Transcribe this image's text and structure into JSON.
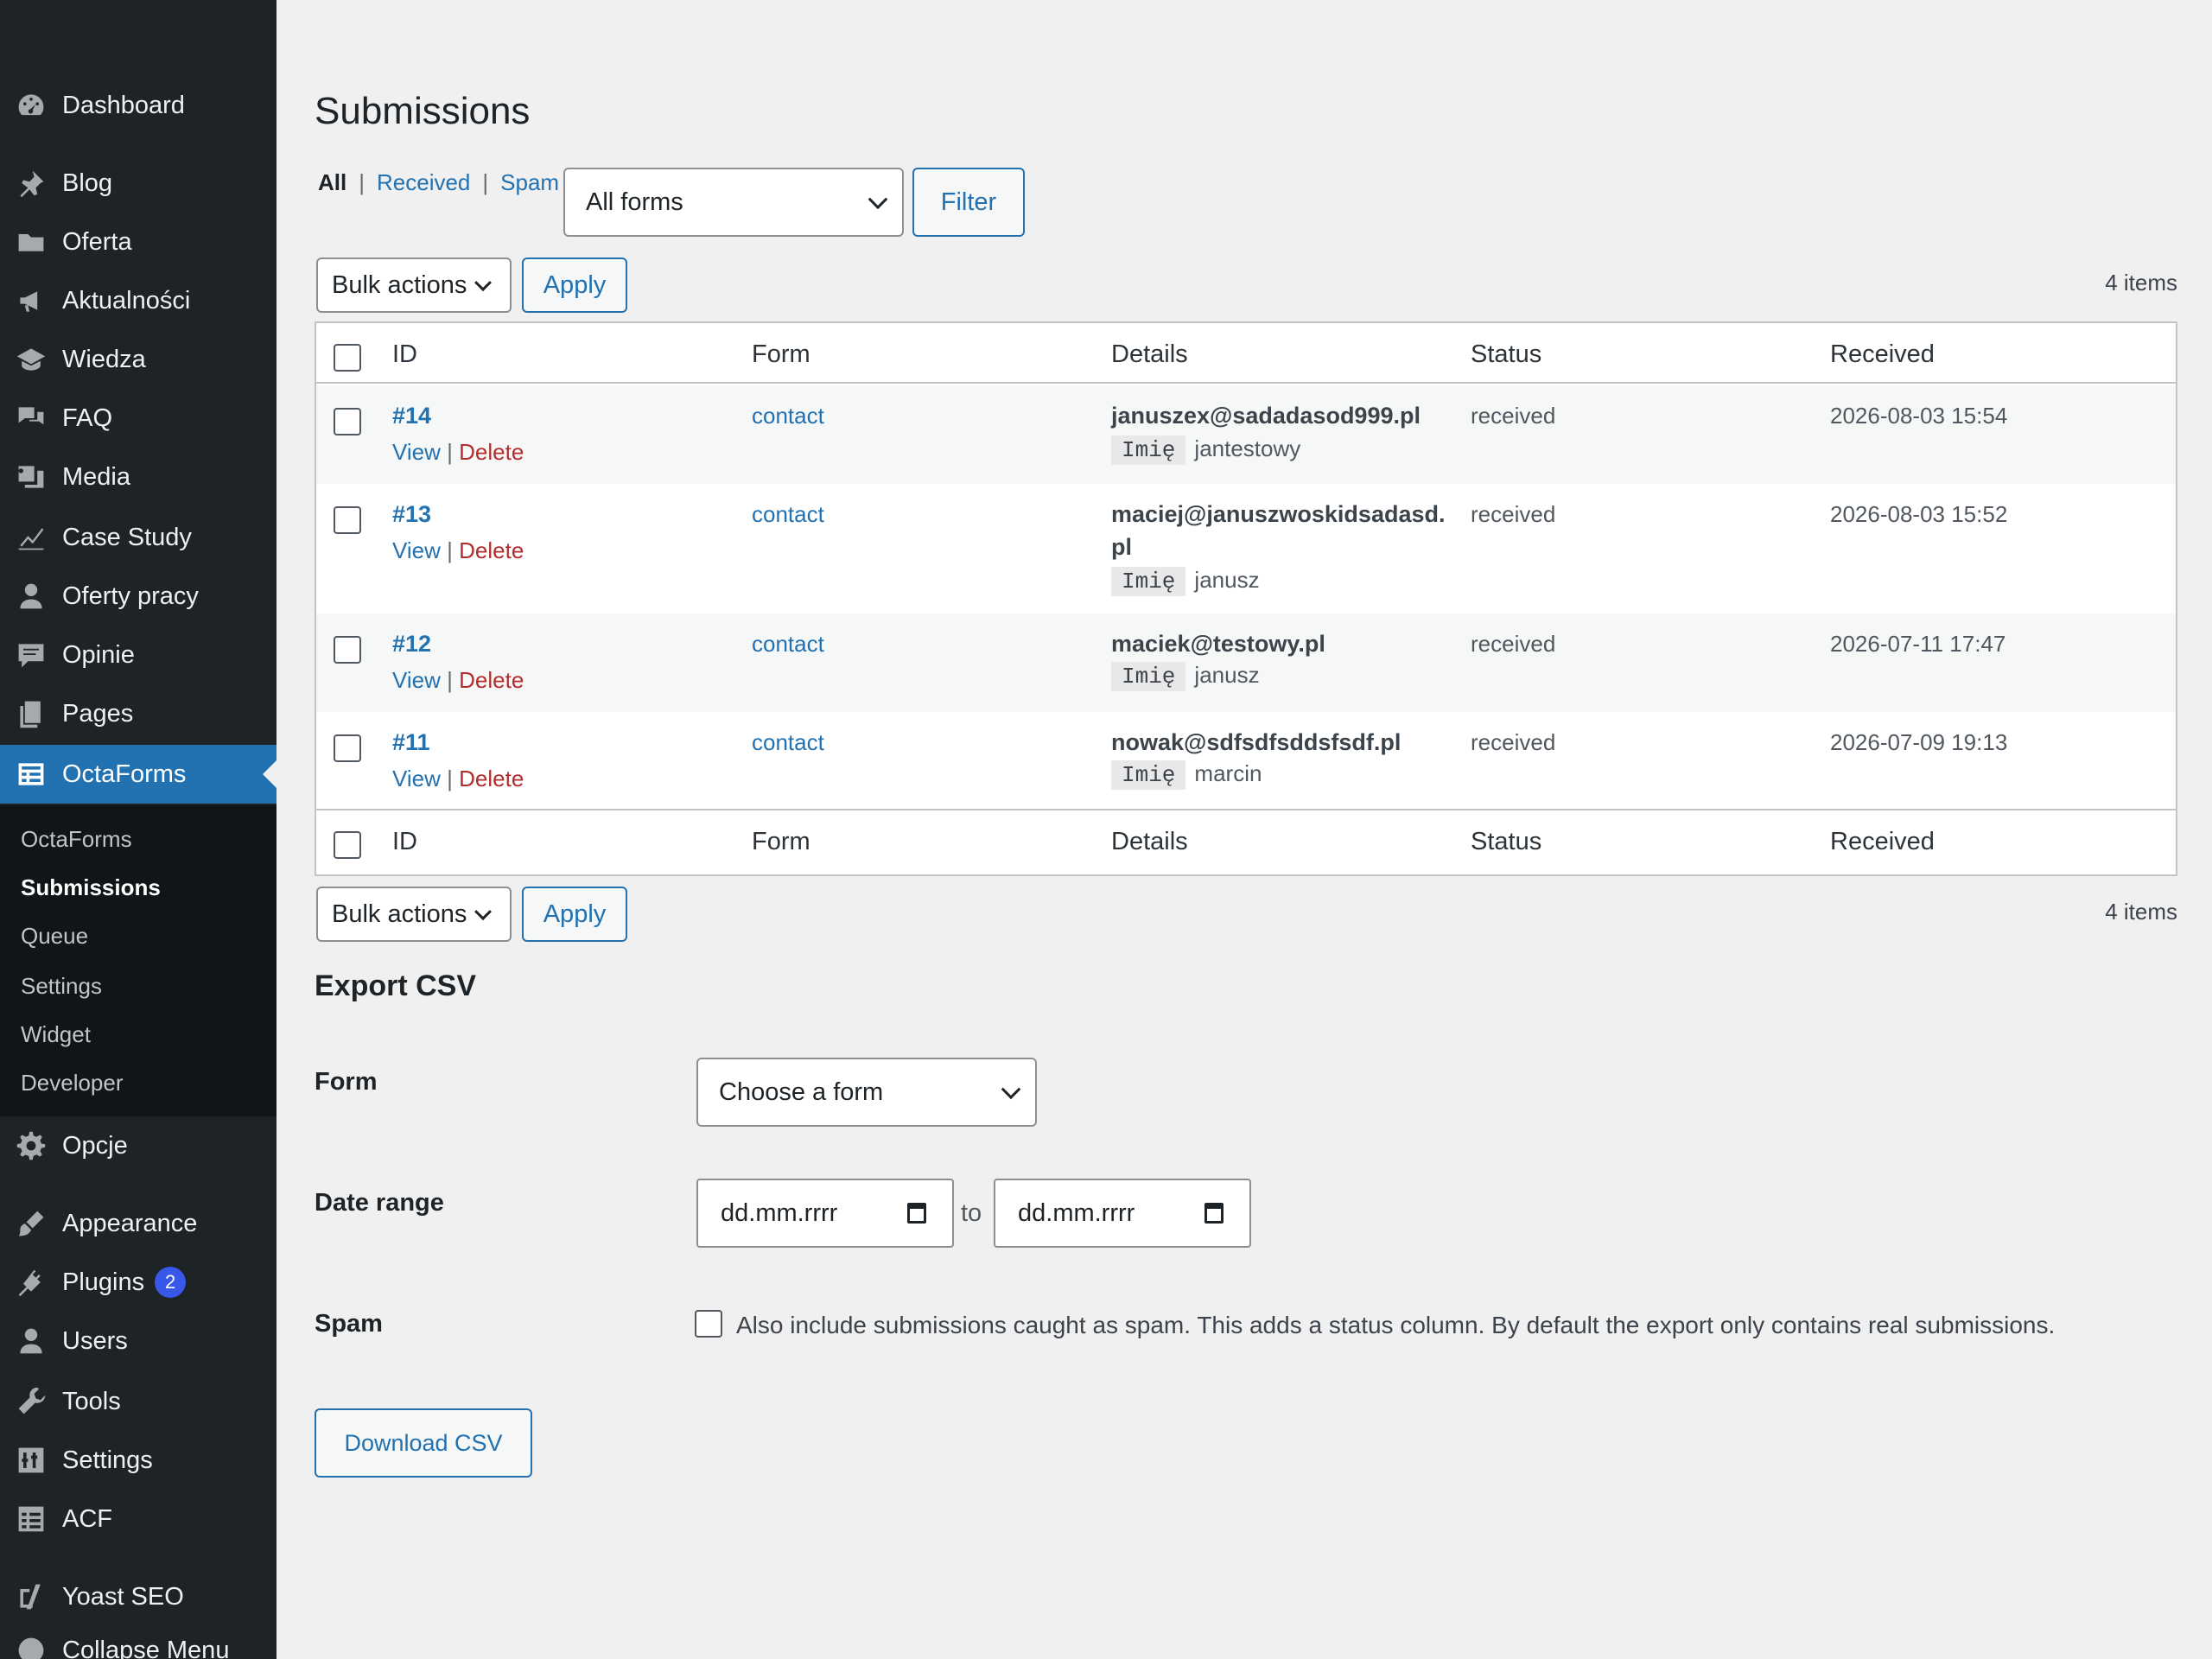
{
  "sidebar": {
    "items": [
      {
        "label": "Dashboard",
        "icon": "dashboard-icon"
      },
      {
        "label": "Blog",
        "icon": "pin-icon"
      },
      {
        "label": "Oferta",
        "icon": "folder-icon"
      },
      {
        "label": "Aktualności",
        "icon": "megaphone-icon"
      },
      {
        "label": "Wiedza",
        "icon": "graduation-cap-icon"
      },
      {
        "label": "FAQ",
        "icon": "chat-bubbles-icon"
      },
      {
        "label": "Media",
        "icon": "media-icon"
      },
      {
        "label": "Case Study",
        "icon": "chart-line-icon"
      },
      {
        "label": "Oferty pracy",
        "icon": "user-icon"
      },
      {
        "label": "Opinie",
        "icon": "comment-icon"
      },
      {
        "label": "Pages",
        "icon": "pages-icon"
      },
      {
        "label": "OctaForms",
        "icon": "form-icon"
      },
      {
        "label": "Opcje",
        "icon": "gear-icon"
      },
      {
        "label": "Appearance",
        "icon": "brush-icon"
      },
      {
        "label": "Plugins",
        "icon": "plug-icon",
        "badge": "2"
      },
      {
        "label": "Users",
        "icon": "users-icon"
      },
      {
        "label": "Tools",
        "icon": "wrench-icon"
      },
      {
        "label": "Settings",
        "icon": "sliders-icon"
      },
      {
        "label": "ACF",
        "icon": "table-icon"
      },
      {
        "label": "Yoast SEO",
        "icon": "yoast-icon"
      },
      {
        "label": "Collapse Menu",
        "icon": "collapse-icon"
      }
    ],
    "submenu": [
      "OctaForms",
      "Submissions",
      "Queue",
      "Settings",
      "Widget",
      "Developer"
    ]
  },
  "page": {
    "title": "Submissions",
    "views": {
      "all": "All",
      "received": "Received",
      "spam": "Spam",
      "sep": "|"
    },
    "form_filter": "All forms",
    "filter_button": "Filter",
    "bulk_actions": "Bulk actions",
    "apply": "Apply",
    "items_count": "4 items"
  },
  "table": {
    "headers": {
      "id": "ID",
      "form": "Form",
      "details": "Details",
      "status": "Status",
      "received": "Received"
    },
    "row_actions": {
      "view": "View",
      "delete": "Delete",
      "sep": "|"
    },
    "rows": [
      {
        "id": "#14",
        "form": "contact",
        "email": "januszex@sadadasod999.pl",
        "field_key": "Imię",
        "field_value": "jantestowy",
        "status": "received",
        "received": "2026-08-03 15:54"
      },
      {
        "id": "#13",
        "form": "contact",
        "email": "maciej@januszwoskidsadasd.",
        "email_cont": "pl",
        "field_key": "Imię",
        "field_value": "janusz",
        "status": "received",
        "received": "2026-08-03 15:52"
      },
      {
        "id": "#12",
        "form": "contact",
        "email": "maciek@testowy.pl",
        "field_key": "Imię",
        "field_value": "janusz",
        "status": "received",
        "received": "2026-07-11 17:47"
      },
      {
        "id": "#11",
        "form": "contact",
        "email": "nowak@sdfsdfsddsfsdf.pl",
        "field_key": "Imię",
        "field_value": "marcin",
        "status": "received",
        "received": "2026-07-09 19:13"
      }
    ]
  },
  "export": {
    "title": "Export CSV",
    "form_label": "Form",
    "form_select": "Choose a form",
    "date_label": "Date range",
    "date_placeholder": "dd.mm.rrrr",
    "to": "to",
    "spam_label": "Spam",
    "spam_text": "Also include submissions caught as spam. This adds a status column. By default the export only contains real submissions.",
    "download_button": "Download CSV"
  }
}
